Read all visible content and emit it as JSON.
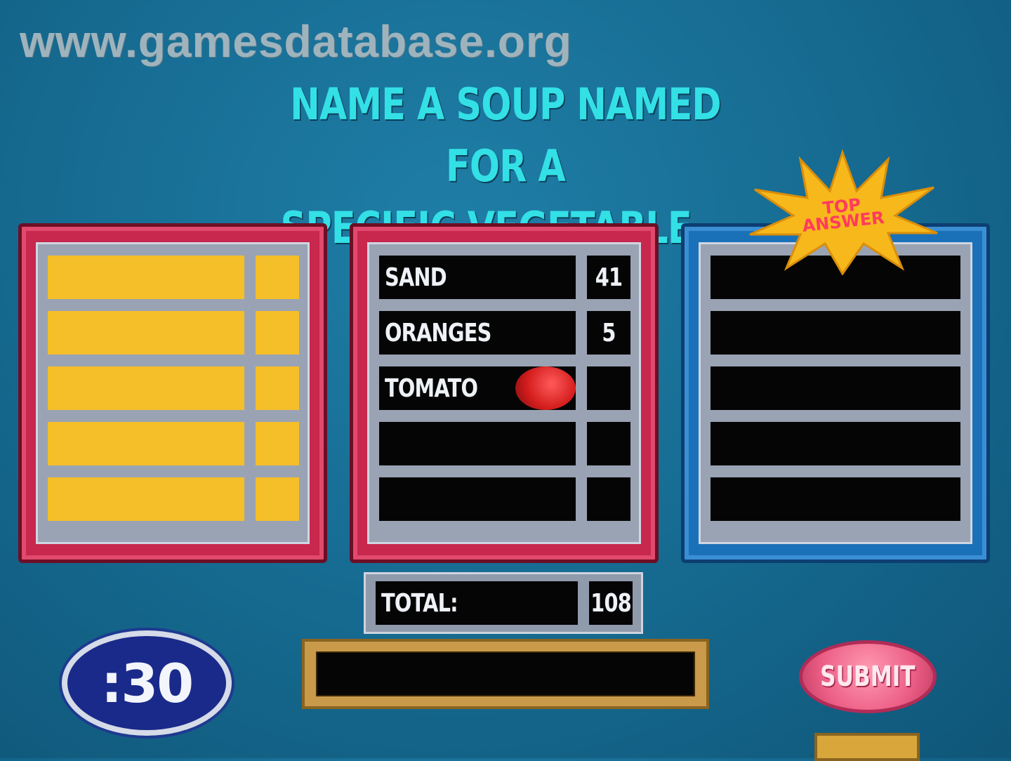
{
  "watermark": "www.gamesdatabase.org",
  "question": {
    "line1": "NAME A SOUP NAMED FOR A",
    "line2": "SPECIFIC VEGETABLE..."
  },
  "badge": {
    "text_line1": "TOP",
    "text_line2": "ANSWER"
  },
  "left_board": {
    "rows": 5,
    "color": "#f5bf2a"
  },
  "middle_board": {
    "answers": [
      {
        "answer": "SAND",
        "points": "41"
      },
      {
        "answer": "ORANGES",
        "points": "5"
      },
      {
        "answer": "TOMATO",
        "points": ""
      },
      {
        "answer": "",
        "points": ""
      },
      {
        "answer": "",
        "points": ""
      }
    ]
  },
  "right_board": {
    "rows": 5
  },
  "total": {
    "label": "TOTAL:",
    "value": "108"
  },
  "timer": {
    "value": ":30"
  },
  "answer_input": {
    "value": ""
  },
  "submit_label": "SUBMIT",
  "colors": {
    "background": "#176d94",
    "question_text": "#33e0e6",
    "red_panel": "#c8274e",
    "blue_panel": "#1b71b8",
    "yellow_tile": "#f5bf2a",
    "submit": "#ec5f86",
    "timer": "#1a2a8a"
  }
}
